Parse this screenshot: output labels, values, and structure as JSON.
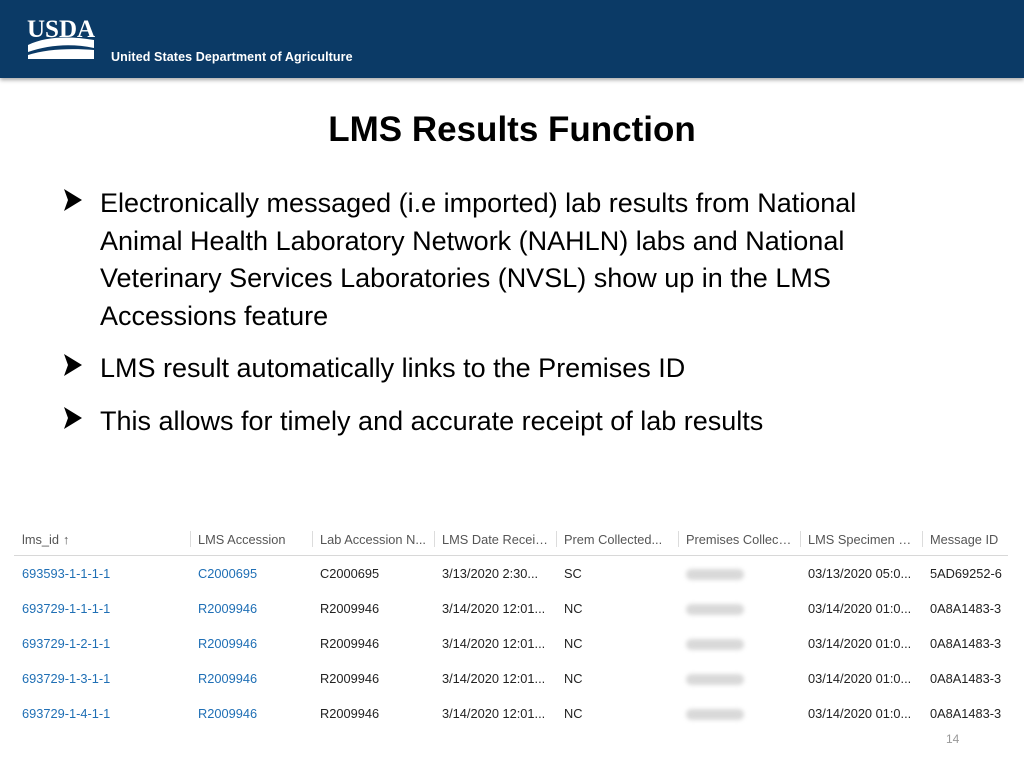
{
  "banner": {
    "logo_text": "USDA",
    "department": "United States Department of Agriculture"
  },
  "slide": {
    "title": "LMS Results Function",
    "bullets": [
      "Electronically messaged (i.e imported) lab results from National Animal Health Laboratory Network (NAHLN) labs and National Veterinary Services Laboratories (NVSL) show up in the LMS Accessions feature",
      "LMS result automatically links to the Premises ID",
      "This allows for timely and accurate receipt of lab results"
    ],
    "page_number": "14"
  },
  "grid": {
    "columns": [
      "lms_id",
      "LMS Accession",
      "Lab Accession N...",
      "LMS Date Receiv...",
      "Prem Collected...",
      "Premises Collect...",
      "LMS Specimen R...",
      "Message ID"
    ],
    "sort_icon": "arrow-up-icon",
    "rows": [
      {
        "lms_id": "693593-1-1-1-1",
        "accession": "C2000695",
        "lab_accession": "C2000695",
        "date_received": "3/13/2020 2:30...",
        "prem_collected": "SC",
        "specimen_received": "03/13/2020 05:0...",
        "message_id": "5AD69252-6"
      },
      {
        "lms_id": "693729-1-1-1-1",
        "accession": "R2009946",
        "lab_accession": "R2009946",
        "date_received": "3/14/2020 12:01...",
        "prem_collected": "NC",
        "specimen_received": "03/14/2020 01:0...",
        "message_id": "0A8A1483-3"
      },
      {
        "lms_id": "693729-1-2-1-1",
        "accession": "R2009946",
        "lab_accession": "R2009946",
        "date_received": "3/14/2020 12:01...",
        "prem_collected": "NC",
        "specimen_received": "03/14/2020 01:0...",
        "message_id": "0A8A1483-3"
      },
      {
        "lms_id": "693729-1-3-1-1",
        "accession": "R2009946",
        "lab_accession": "R2009946",
        "date_received": "3/14/2020 12:01...",
        "prem_collected": "NC",
        "specimen_received": "03/14/2020 01:0...",
        "message_id": "0A8A1483-3"
      },
      {
        "lms_id": "693729-1-4-1-1",
        "accession": "R2009946",
        "lab_accession": "R2009946",
        "date_received": "3/14/2020 12:01...",
        "prem_collected": "NC",
        "specimen_received": "03/14/2020 01:0...",
        "message_id": "0A8A1483-3"
      }
    ]
  },
  "colors": {
    "banner": "#0b3a66",
    "link": "#1f6fb5"
  }
}
